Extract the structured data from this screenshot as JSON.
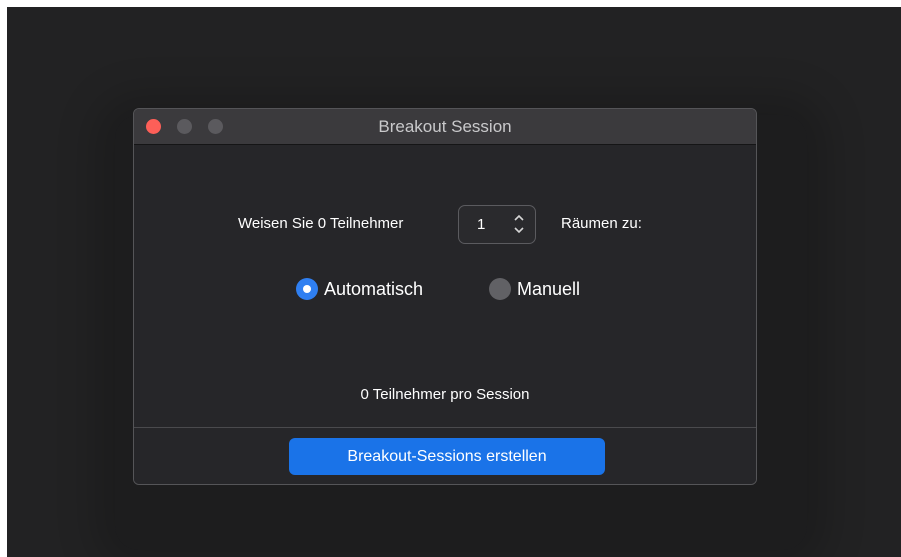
{
  "window": {
    "title": "Breakout Session"
  },
  "assign": {
    "prefix": "Weisen Sie 0 Teilnehmer",
    "rooms_value": "1",
    "suffix": "Räumen zu:"
  },
  "mode": {
    "automatic_label": "Automatisch",
    "manual_label": "Manuell",
    "selected": "Automatisch"
  },
  "summary": {
    "participants_per_session": "0 Teilnehmer pro Session"
  },
  "actions": {
    "create_label": "Breakout-Sessions erstellen"
  },
  "colors": {
    "accent": "#1a73e8",
    "close": "#fd5f58",
    "window_bg": "#262629"
  }
}
